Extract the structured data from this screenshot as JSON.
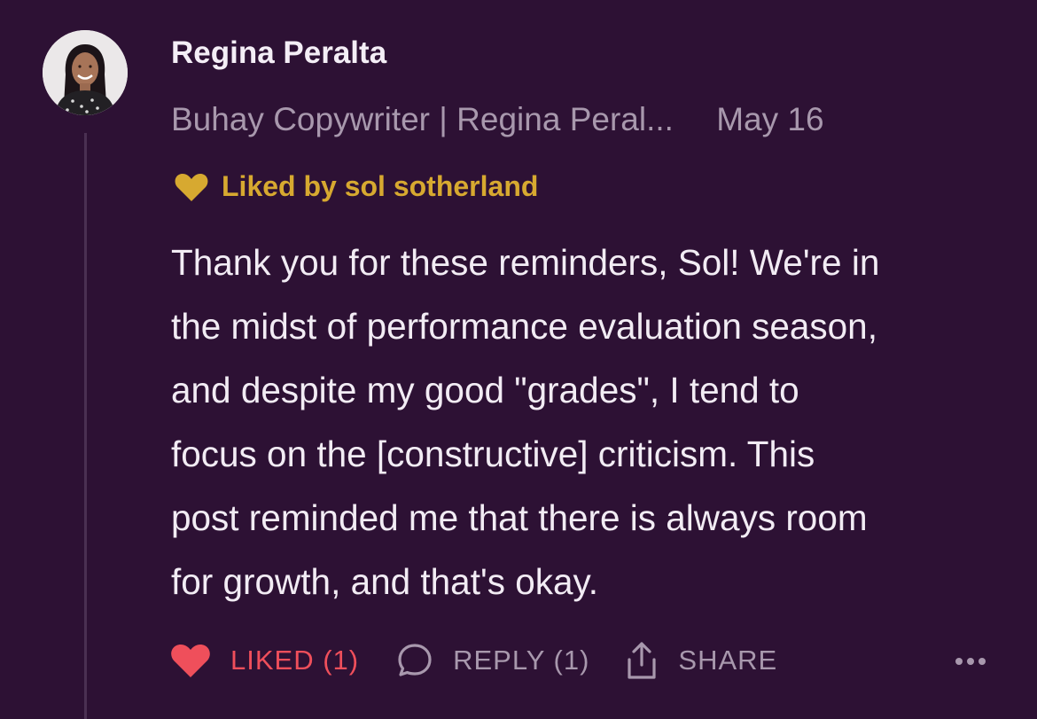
{
  "comment": {
    "author": "Regina Peralta",
    "publication": "Buhay Copywriter | Regina Peral...",
    "date": "May 16",
    "liked_by": "Liked by sol sotherland",
    "body_lines": [
      "Thank you for these reminders, Sol! We're in",
      "the midst of performance evaluation season,",
      "and despite my good \"grades\", I tend to",
      "focus on the [constructive] criticism. This",
      "post reminded me that there is always room",
      "for growth, and that's okay."
    ]
  },
  "actions": {
    "like_label": "LIKED (1)",
    "reply_label": "REPLY (1)",
    "share_label": "SHARE"
  },
  "icons": {
    "avatar": "avatar-photo",
    "liked_by": "heart-icon",
    "like": "heart-icon",
    "reply": "speech-bubble-icon",
    "share": "share-icon",
    "more": "more-horizontal-icon"
  },
  "colors": {
    "background": "#2d1134",
    "accent_gold": "#d7a930",
    "liked_red": "#ef4f5b",
    "muted": "#a898ad",
    "text": "#f2ecf4"
  }
}
